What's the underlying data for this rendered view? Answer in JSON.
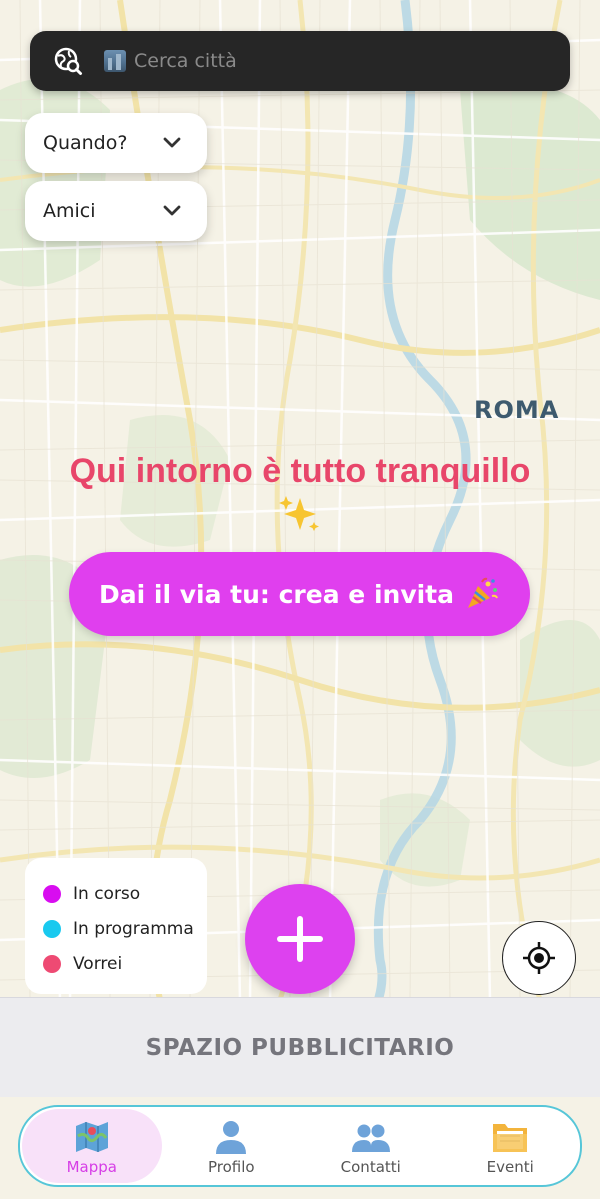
{
  "search": {
    "placeholder": "Cerca città"
  },
  "filters": [
    {
      "label": "Quando?"
    },
    {
      "label": "Amici"
    }
  ],
  "map": {
    "city_label": "ROMA"
  },
  "empty_state": {
    "title": "Qui intorno è tutto tranquillo",
    "cta_label": "Dai il via tu: crea e invita"
  },
  "legend": {
    "items": [
      {
        "label": "In corso",
        "color": "#d80df0"
      },
      {
        "label": "In programma",
        "color": "#19c9ef"
      },
      {
        "label": "Vorrei",
        "color": "#ee4a73"
      }
    ]
  },
  "ad": {
    "label": "SPAZIO PUBBLICITARIO"
  },
  "nav": {
    "items": [
      {
        "label": "Mappa",
        "icon": "map-icon",
        "active": true
      },
      {
        "label": "Profilo",
        "icon": "person-icon",
        "active": false
      },
      {
        "label": "Contatti",
        "icon": "people-icon",
        "active": false
      },
      {
        "label": "Eventi",
        "icon": "folder-icon",
        "active": false
      }
    ]
  },
  "colors": {
    "accent": "#e03fee",
    "title": "#e8466a",
    "nav_border": "#56c6d8"
  }
}
